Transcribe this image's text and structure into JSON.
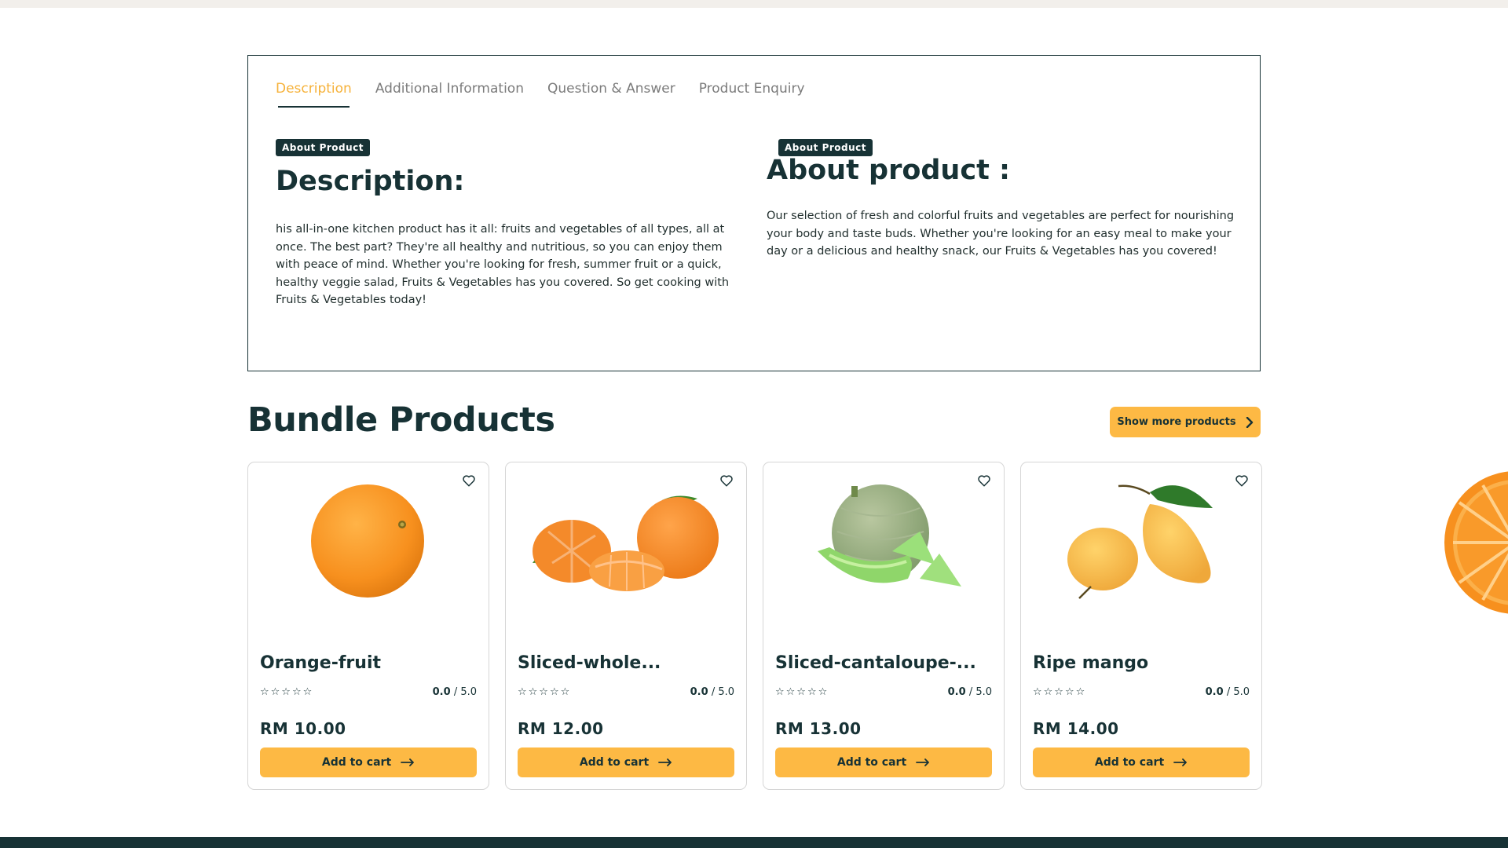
{
  "tabs": [
    {
      "label": "Description",
      "active": true
    },
    {
      "label": "Additional Information",
      "active": false
    },
    {
      "label": "Question & Answer",
      "active": false
    },
    {
      "label": "Product Enquiry",
      "active": false
    }
  ],
  "description": {
    "badge": "About Product",
    "heading": "Description:",
    "text": "his all-in-one kitchen product has it all: fruits and vegetables of all types, all at once. The best part? They're all healthy and nutritious, so you can enjoy them with peace of mind. Whether you're looking for fresh, summer fruit or a quick, healthy veggie salad, Fruits & Vegetables has you covered. So get cooking with Fruits & Vegetables today!"
  },
  "about": {
    "badge": "About Product",
    "heading": "About product :",
    "text": "Our selection of fresh and colorful fruits and vegetables are perfect for nourishing your body and taste buds. Whether you're looking for an easy meal to make your day or a delicious and healthy snack, our Fruits & Vegetables has you covered!"
  },
  "bundle": {
    "title": "Bundle Products",
    "show_more_label": "Show more products"
  },
  "products": [
    {
      "name": "Orange-fruit",
      "stars": "☆☆☆☆☆",
      "rating": "0.0",
      "rating_max": "/ 5.0",
      "price": "RM 10.00",
      "cart_label": "Add to cart",
      "image": "orange-image"
    },
    {
      "name": "Sliced-whole...",
      "stars": "☆☆☆☆☆",
      "rating": "0.0",
      "rating_max": "/ 5.0",
      "price": "RM 12.00",
      "cart_label": "Add to cart",
      "image": "mandarin-image"
    },
    {
      "name": "Sliced-cantaloupe-...",
      "stars": "☆☆☆☆☆",
      "rating": "0.0",
      "rating_max": "/ 5.0",
      "price": "RM 13.00",
      "cart_label": "Add to cart",
      "image": "cantaloupe-image"
    },
    {
      "name": "Ripe mango",
      "stars": "☆☆☆☆☆",
      "rating": "0.0",
      "rating_max": "/ 5.0",
      "price": "RM 14.00",
      "cart_label": "Add to cart",
      "image": "mango-image"
    }
  ],
  "colors": {
    "accent": "#fdb944",
    "dark": "#173235",
    "tab_active": "#f6b23a"
  }
}
